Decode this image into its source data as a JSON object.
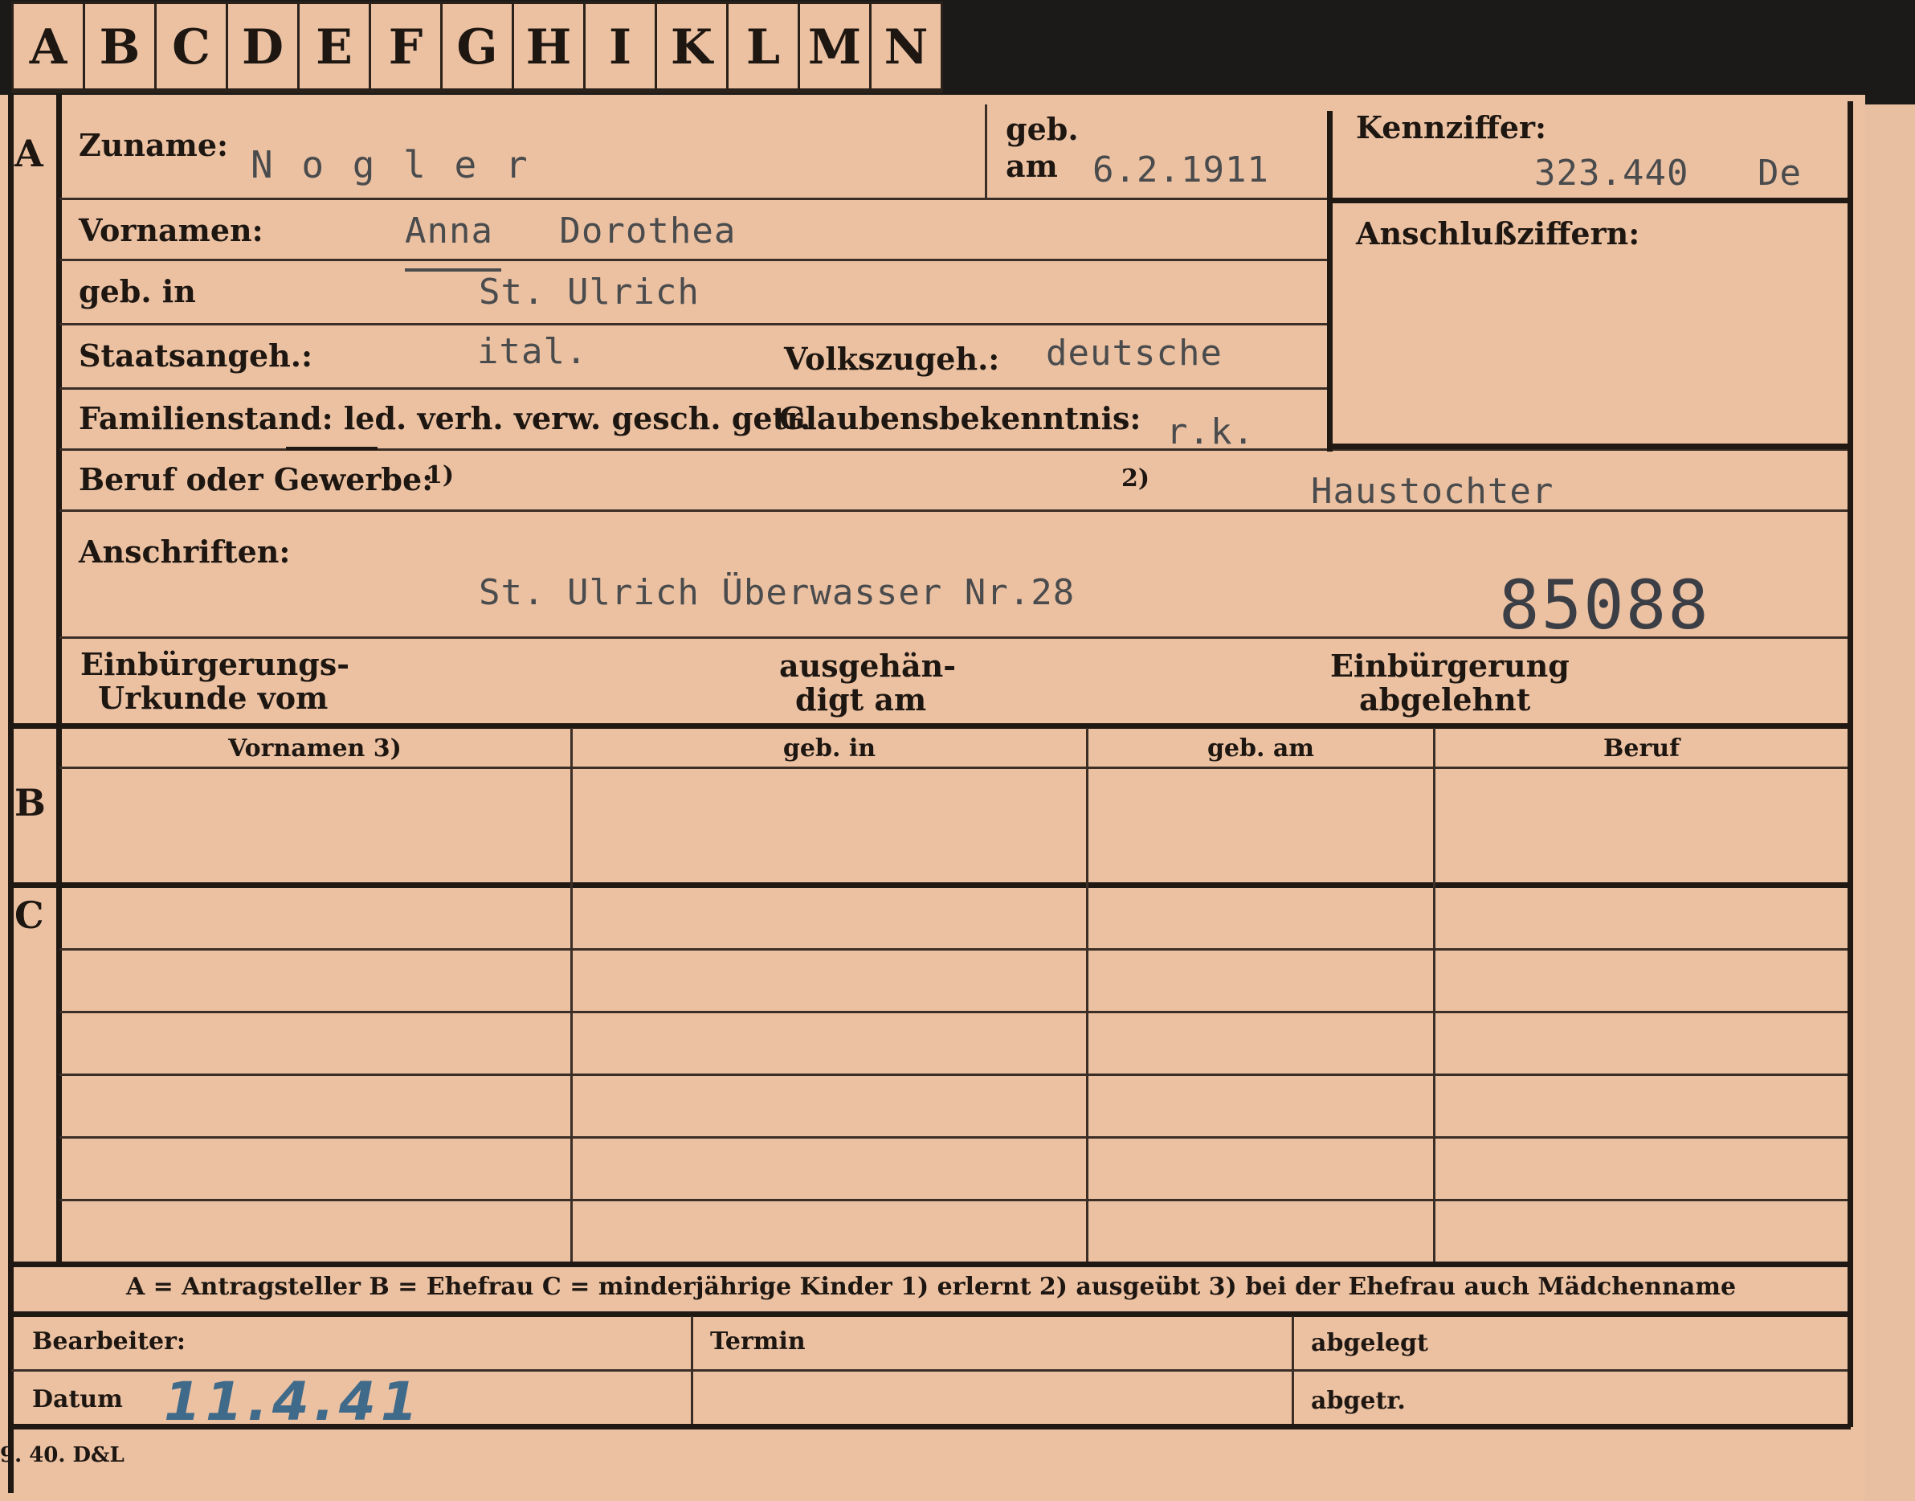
{
  "tabs": [
    "A",
    "B",
    "C",
    "D",
    "E",
    "F",
    "G",
    "H",
    "I",
    "K",
    "L",
    "M",
    "N"
  ],
  "sections": {
    "a": "A",
    "b": "B",
    "c": "C"
  },
  "fields": {
    "zuname_label": "Zuname:",
    "zuname_value": "N o g l e r",
    "geb_label": "geb.",
    "am_label": "am",
    "geb_am_value": "6.2.1911",
    "kennziffer_label": "Kennziffer:",
    "kennziffer_value": "323.440",
    "kennziffer_suffix": "De",
    "vornamen_label": "Vornamen:",
    "vornamen_value": "Anna   Dorothea",
    "anschluss_label": "Anschlußziffern:",
    "geb_in_label": "geb. in",
    "geb_in_value": "St. Ulrich",
    "staats_label": "Staatsangeh.:",
    "staats_value": "ital.",
    "volks_label": "Volkszugeh.:",
    "volks_value": "deutsche",
    "familien_label": "Familienstand: led. verh. verw. gesch. getr.",
    "glauben_label": "Glaubensbekenntnis:",
    "glauben_value": "r.k.",
    "beruf_label": "Beruf oder Gewerbe:",
    "beruf_n1": "1)",
    "beruf_n2": "2)",
    "beruf_value": "Haustochter",
    "anschriften_label": "Anschriften:",
    "anschriften_value": "St. Ulrich Überwasser Nr.28",
    "big_number": "85088",
    "einb_urkunde_1": "Einbürgerungs-",
    "einb_urkunde_2": "Urkunde vom",
    "ausgehaendigt_1": "ausgehän-",
    "ausgehaendigt_2": "digt am",
    "einb_abgelehnt_1": "Einbürgerung",
    "einb_abgelehnt_2": "abgelehnt"
  },
  "table": {
    "headers": [
      "Vornamen 3)",
      "geb. in",
      "geb. am",
      "Beruf"
    ]
  },
  "legend": "A = Antragsteller   B = Ehefrau   C = minderjährige Kinder   1) erlernt   2) ausgeübt   3) bei der Ehefrau auch Mädchenname",
  "footer": {
    "bearbeiter_label": "Bearbeiter:",
    "datum_label": "Datum",
    "datum_value": "11.4.41",
    "termin_label": "Termin",
    "abgelegt_label": "abgelegt",
    "abgetr_label": "abgetr.",
    "print_code": "9. 40. D&L"
  },
  "colors": {
    "card": "#ebc1a2",
    "ink": "#1d1611",
    "typed": "#4a4b4d",
    "pencil_blue": "#3f6a8a"
  }
}
